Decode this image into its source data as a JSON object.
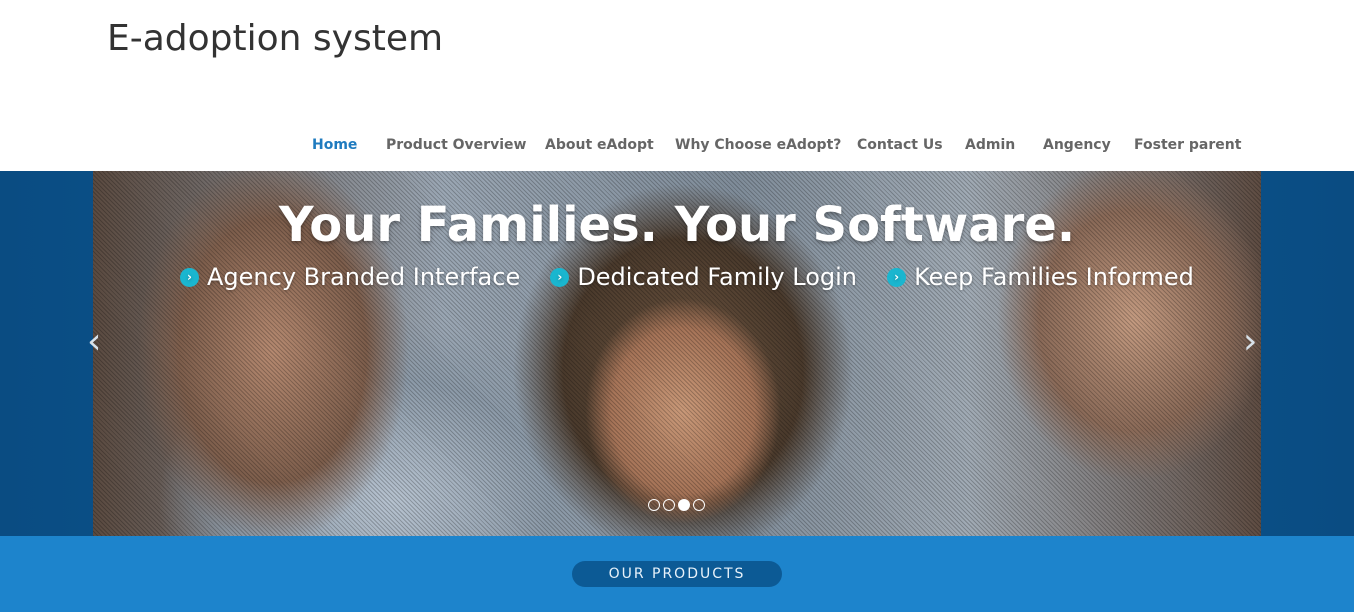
{
  "site": {
    "title": "E-adoption system"
  },
  "nav": {
    "home": "Home",
    "product_overview": "Product Overview",
    "about": "About eAdopt",
    "why_choose": "Why Choose eAdopt?",
    "contact": "Contact Us",
    "admin": "Admin",
    "agency": "Angency",
    "foster_parent": "Foster parent"
  },
  "hero": {
    "title": "Your Families. Your Software.",
    "features": [
      "Agency Branded Interface",
      "Dedicated Family Login",
      "Keep Families Informed"
    ],
    "feature_icon": "chevron-right-circle-icon",
    "prev_icon": "‹",
    "next_icon": "›",
    "slide_count": 4,
    "active_slide": 3
  },
  "band": {
    "button_label": "OUR PRODUCTS"
  },
  "colors": {
    "nav_active": "#1f7bbf",
    "feature_icon": "#1ab6cf",
    "band": "#1d84cc",
    "button": "#0c5a95"
  }
}
